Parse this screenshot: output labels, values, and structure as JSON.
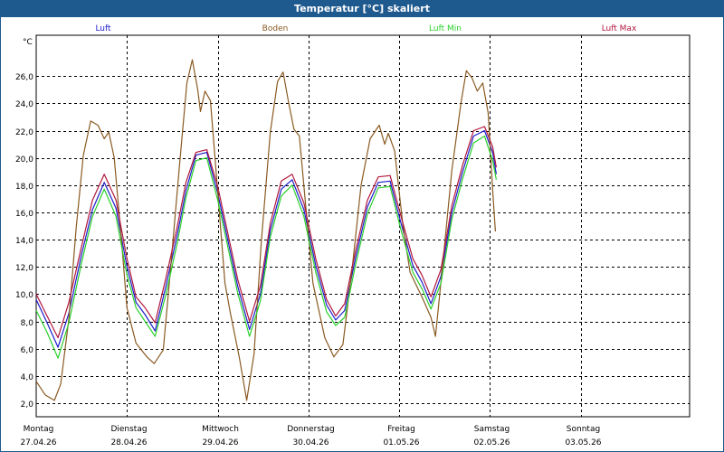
{
  "window": {
    "title": "Temperatur [°C] skaliert"
  },
  "chart_data": {
    "type": "line",
    "ylabel": "°C",
    "ylim": [
      1.0,
      29.0
    ],
    "yticks": [
      2.0,
      4.0,
      6.0,
      8.0,
      10.0,
      12.0,
      14.0,
      16.0,
      18.0,
      20.0,
      22.0,
      24.0,
      26.0
    ],
    "xlim": [
      0.0,
      7.2
    ],
    "days": [
      {
        "name": "Montag",
        "date": "27.04.26",
        "x": 0
      },
      {
        "name": "Dienstag",
        "date": "28.04.26",
        "x": 1
      },
      {
        "name": "Mittwoch",
        "date": "29.04.26",
        "x": 2
      },
      {
        "name": "Donnerstag",
        "date": "30.04.26",
        "x": 3
      },
      {
        "name": "Freitag",
        "date": "01.05.26",
        "x": 4
      },
      {
        "name": "Samstag",
        "date": "02.05.26",
        "x": 5
      },
      {
        "name": "Sonntag",
        "date": "03.05.26",
        "x": 6
      }
    ],
    "grid": true,
    "legend": "top",
    "series": [
      {
        "name": "Luft",
        "color": "#1c1ccc",
        "points": [
          [
            0.0,
            9.6
          ],
          [
            0.12,
            7.9
          ],
          [
            0.24,
            6.1
          ],
          [
            0.36,
            8.6
          ],
          [
            0.5,
            12.9
          ],
          [
            0.62,
            16.2
          ],
          [
            0.75,
            18.2
          ],
          [
            0.88,
            16.3
          ],
          [
            1.0,
            12.0
          ],
          [
            1.1,
            9.4
          ],
          [
            1.2,
            8.5
          ],
          [
            1.31,
            7.3
          ],
          [
            1.43,
            10.6
          ],
          [
            1.55,
            14.2
          ],
          [
            1.65,
            17.6
          ],
          [
            1.76,
            20.2
          ],
          [
            1.88,
            20.4
          ],
          [
            2.0,
            17.4
          ],
          [
            2.12,
            13.7
          ],
          [
            2.22,
            10.6
          ],
          [
            2.35,
            7.4
          ],
          [
            2.47,
            10.0
          ],
          [
            2.58,
            14.7
          ],
          [
            2.7,
            17.7
          ],
          [
            2.82,
            18.4
          ],
          [
            2.95,
            16.2
          ],
          [
            3.08,
            12.1
          ],
          [
            3.2,
            9.2
          ],
          [
            3.3,
            8.1
          ],
          [
            3.4,
            8.8
          ],
          [
            3.52,
            12.7
          ],
          [
            3.65,
            16.4
          ],
          [
            3.77,
            18.2
          ],
          [
            3.9,
            18.3
          ],
          [
            4.02,
            15.2
          ],
          [
            4.15,
            12.1
          ],
          [
            4.25,
            10.9
          ],
          [
            4.35,
            9.3
          ],
          [
            4.46,
            11.3
          ],
          [
            4.58,
            16.0
          ],
          [
            4.7,
            19.0
          ],
          [
            4.82,
            21.6
          ],
          [
            4.94,
            22.0
          ],
          [
            5.03,
            20.4
          ],
          [
            5.07,
            18.8
          ]
        ]
      },
      {
        "name": "Boden",
        "color": "#8a5a22",
        "points": [
          [
            0.0,
            3.6
          ],
          [
            0.1,
            2.6
          ],
          [
            0.2,
            2.2
          ],
          [
            0.27,
            3.4
          ],
          [
            0.36,
            8.2
          ],
          [
            0.44,
            14.8
          ],
          [
            0.52,
            20.2
          ],
          [
            0.6,
            22.7
          ],
          [
            0.68,
            22.4
          ],
          [
            0.75,
            21.4
          ],
          [
            0.8,
            21.9
          ],
          [
            0.86,
            20.0
          ],
          [
            0.94,
            13.9
          ],
          [
            1.0,
            9.0
          ],
          [
            1.1,
            6.4
          ],
          [
            1.22,
            5.4
          ],
          [
            1.3,
            4.9
          ],
          [
            1.4,
            5.9
          ],
          [
            1.48,
            11.8
          ],
          [
            1.58,
            19.5
          ],
          [
            1.66,
            25.5
          ],
          [
            1.72,
            27.2
          ],
          [
            1.78,
            25.0
          ],
          [
            1.81,
            23.4
          ],
          [
            1.86,
            24.9
          ],
          [
            1.92,
            24.2
          ],
          [
            2.0,
            17.5
          ],
          [
            2.08,
            10.8
          ],
          [
            2.14,
            8.6
          ],
          [
            2.24,
            5.3
          ],
          [
            2.32,
            2.2
          ],
          [
            2.4,
            5.6
          ],
          [
            2.48,
            13.8
          ],
          [
            2.58,
            21.9
          ],
          [
            2.66,
            25.6
          ],
          [
            2.72,
            26.3
          ],
          [
            2.78,
            24.1
          ],
          [
            2.84,
            22.1
          ],
          [
            2.9,
            21.6
          ],
          [
            2.96,
            17.2
          ],
          [
            3.05,
            10.8
          ],
          [
            3.18,
            6.8
          ],
          [
            3.28,
            5.4
          ],
          [
            3.38,
            6.3
          ],
          [
            3.48,
            11.8
          ],
          [
            3.58,
            18.0
          ],
          [
            3.68,
            21.4
          ],
          [
            3.78,
            22.4
          ],
          [
            3.84,
            21.0
          ],
          [
            3.88,
            21.8
          ],
          [
            3.95,
            20.5
          ],
          [
            4.04,
            15.1
          ],
          [
            4.12,
            11.6
          ],
          [
            4.25,
            9.8
          ],
          [
            4.35,
            8.3
          ],
          [
            4.4,
            6.9
          ],
          [
            4.48,
            12.2
          ],
          [
            4.58,
            19.1
          ],
          [
            4.68,
            24.0
          ],
          [
            4.74,
            26.4
          ],
          [
            4.8,
            25.9
          ],
          [
            4.86,
            24.9
          ],
          [
            4.92,
            25.5
          ],
          [
            4.98,
            23.3
          ],
          [
            5.03,
            17.6
          ],
          [
            5.06,
            14.6
          ]
        ]
      },
      {
        "name": "Luft Min",
        "color": "#2ad02a",
        "points": [
          [
            0.0,
            8.8
          ],
          [
            0.12,
            7.2
          ],
          [
            0.24,
            5.3
          ],
          [
            0.36,
            7.9
          ],
          [
            0.5,
            12.3
          ],
          [
            0.62,
            15.7
          ],
          [
            0.75,
            17.7
          ],
          [
            0.88,
            15.7
          ],
          [
            1.0,
            11.4
          ],
          [
            1.1,
            9.0
          ],
          [
            1.2,
            8.0
          ],
          [
            1.31,
            6.9
          ],
          [
            1.43,
            10.0
          ],
          [
            1.55,
            13.6
          ],
          [
            1.65,
            17.1
          ],
          [
            1.76,
            19.8
          ],
          [
            1.88,
            20.0
          ],
          [
            2.0,
            16.9
          ],
          [
            2.12,
            13.2
          ],
          [
            2.22,
            10.1
          ],
          [
            2.35,
            6.9
          ],
          [
            2.47,
            9.5
          ],
          [
            2.58,
            14.2
          ],
          [
            2.7,
            17.2
          ],
          [
            2.82,
            18.0
          ],
          [
            2.95,
            15.7
          ],
          [
            3.08,
            11.6
          ],
          [
            3.2,
            8.7
          ],
          [
            3.3,
            7.7
          ],
          [
            3.4,
            8.3
          ],
          [
            3.52,
            12.2
          ],
          [
            3.65,
            15.9
          ],
          [
            3.77,
            17.8
          ],
          [
            3.9,
            17.9
          ],
          [
            4.02,
            14.7
          ],
          [
            4.15,
            11.6
          ],
          [
            4.25,
            10.4
          ],
          [
            4.35,
            8.9
          ],
          [
            4.46,
            10.8
          ],
          [
            4.58,
            15.5
          ],
          [
            4.7,
            18.5
          ],
          [
            4.82,
            21.1
          ],
          [
            4.94,
            21.6
          ],
          [
            5.03,
            19.8
          ],
          [
            5.07,
            18.4
          ]
        ]
      },
      {
        "name": "Luft Max",
        "color": "#b0173c",
        "points": [
          [
            0.0,
            10.0
          ],
          [
            0.12,
            8.4
          ],
          [
            0.24,
            6.8
          ],
          [
            0.36,
            9.4
          ],
          [
            0.5,
            13.5
          ],
          [
            0.62,
            16.9
          ],
          [
            0.75,
            18.8
          ],
          [
            0.88,
            16.9
          ],
          [
            1.0,
            12.6
          ],
          [
            1.1,
            9.8
          ],
          [
            1.2,
            9.0
          ],
          [
            1.31,
            7.9
          ],
          [
            1.43,
            11.2
          ],
          [
            1.55,
            14.8
          ],
          [
            1.65,
            18.2
          ],
          [
            1.76,
            20.4
          ],
          [
            1.88,
            20.6
          ],
          [
            2.0,
            17.9
          ],
          [
            2.12,
            14.2
          ],
          [
            2.22,
            11.1
          ],
          [
            2.35,
            8.0
          ],
          [
            2.47,
            10.6
          ],
          [
            2.58,
            15.2
          ],
          [
            2.7,
            18.3
          ],
          [
            2.82,
            18.8
          ],
          [
            2.95,
            16.7
          ],
          [
            3.08,
            12.6
          ],
          [
            3.2,
            9.6
          ],
          [
            3.3,
            8.4
          ],
          [
            3.4,
            9.3
          ],
          [
            3.52,
            13.2
          ],
          [
            3.65,
            16.9
          ],
          [
            3.77,
            18.6
          ],
          [
            3.9,
            18.7
          ],
          [
            4.02,
            15.7
          ],
          [
            4.15,
            12.6
          ],
          [
            4.25,
            11.4
          ],
          [
            4.35,
            9.8
          ],
          [
            4.46,
            11.8
          ],
          [
            4.58,
            16.5
          ],
          [
            4.7,
            19.5
          ],
          [
            4.82,
            22.0
          ],
          [
            4.94,
            22.3
          ],
          [
            5.03,
            20.8
          ],
          [
            5.07,
            19.3
          ]
        ]
      }
    ]
  }
}
